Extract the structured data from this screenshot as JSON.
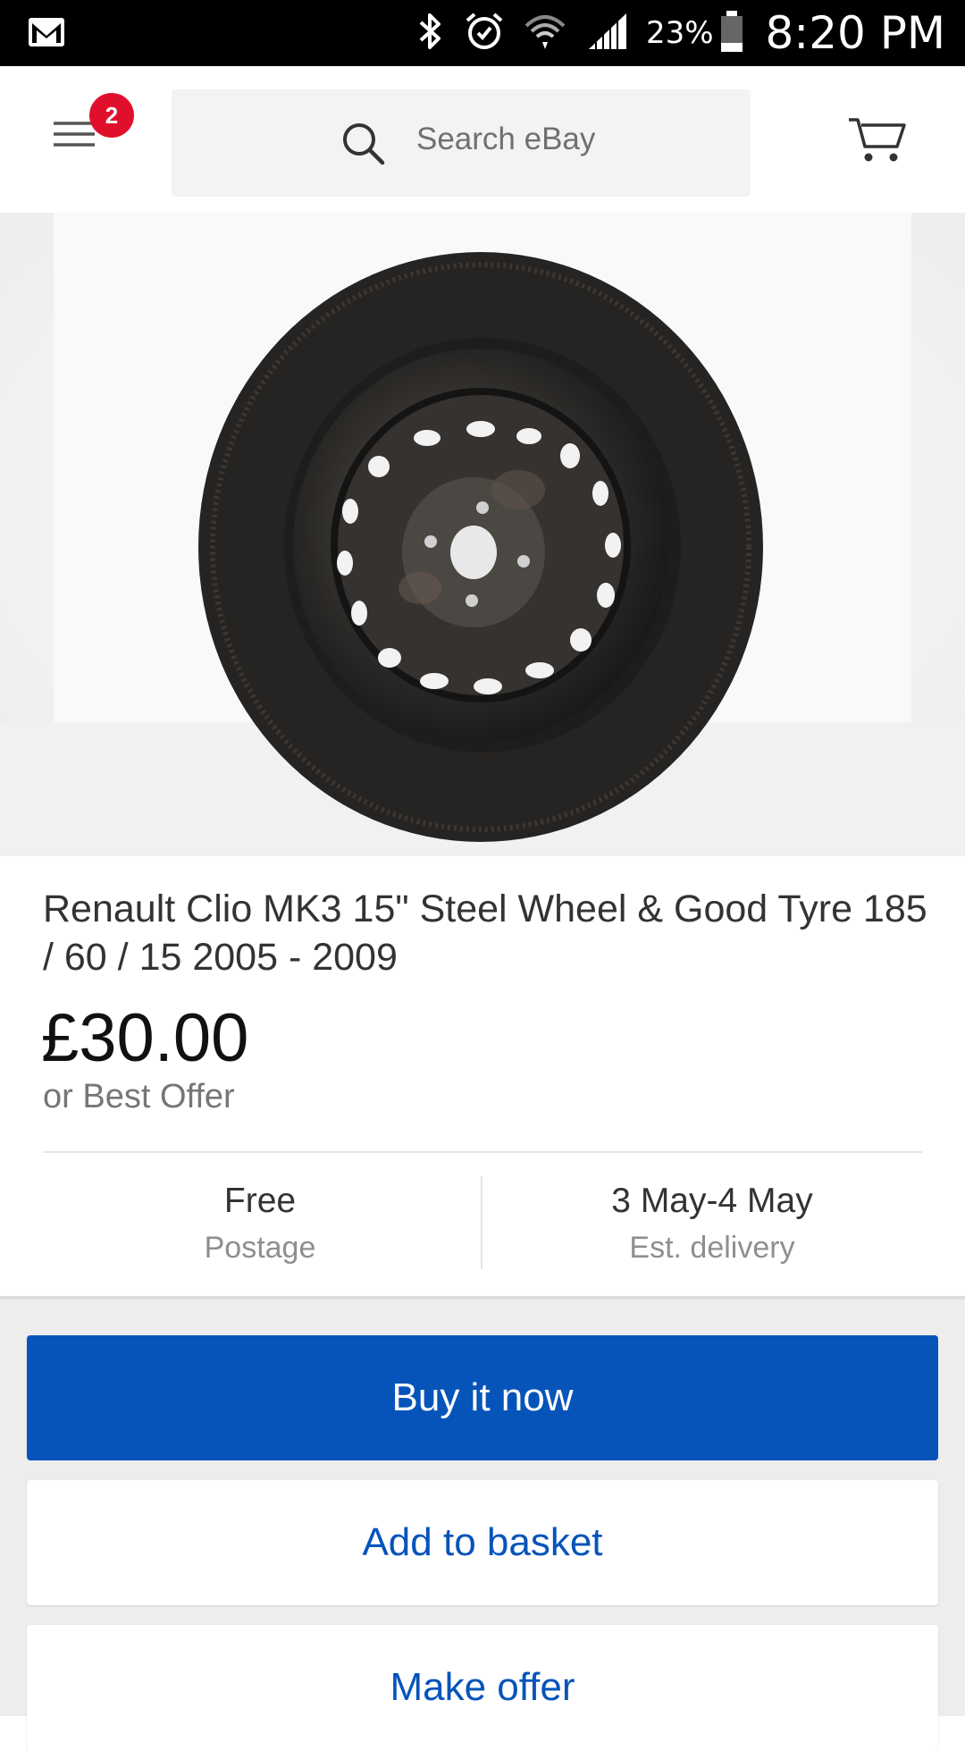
{
  "status_bar": {
    "battery_percent": "23%",
    "time": "8:20 PM",
    "icons": [
      "gmail-icon",
      "bluetooth-icon",
      "alarm-icon",
      "wifi-icon",
      "signal-icon",
      "battery-icon"
    ]
  },
  "header": {
    "notification_count": "2",
    "search_placeholder": "Search eBay"
  },
  "listing": {
    "title": "Renault Clio MK3 15\" Steel Wheel & Good Tyre 185 / 60 / 15 2005 - 2009",
    "price": "£30.00",
    "best_offer": "or Best Offer",
    "postage_main": "Free",
    "postage_sub": "Postage",
    "delivery_main": "3 May-4 May",
    "delivery_sub": "Est. delivery"
  },
  "actions": {
    "buy_now": "Buy it now",
    "add_to_basket": "Add to basket",
    "make_offer": "Make offer"
  },
  "colors": {
    "primary": "#0654ba",
    "badge": "#e0102c"
  }
}
